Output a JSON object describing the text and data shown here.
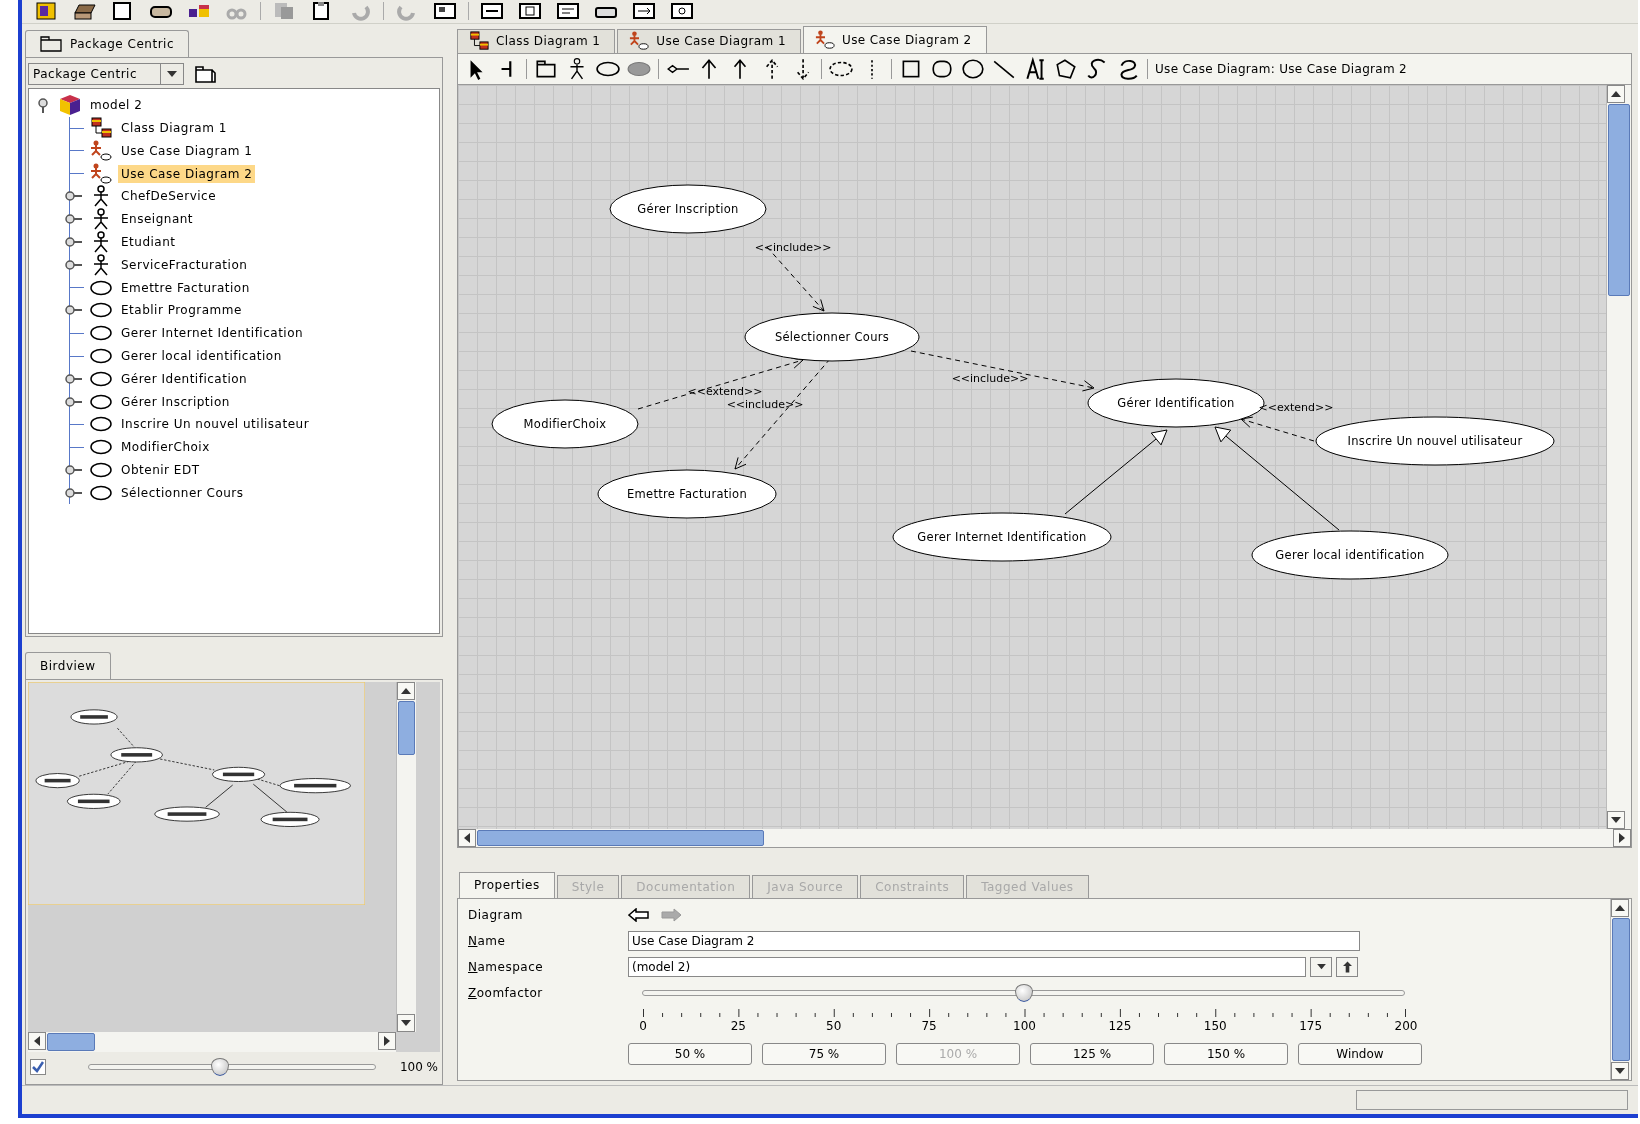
{
  "navigator": {
    "tab": "Package Centric",
    "perspective": "Package Centric",
    "tree": {
      "label": "model 2",
      "kind": "model",
      "expanded": true,
      "selected": false,
      "children": [
        {
          "label": "Class Diagram 1",
          "kind": "class-diagram",
          "expandable": false,
          "selected": false
        },
        {
          "label": "Use Case Diagram 1",
          "kind": "usecase-diagram",
          "expandable": false,
          "selected": false
        },
        {
          "label": "Use Case Diagram 2",
          "kind": "usecase-diagram",
          "expandable": false,
          "selected": true
        },
        {
          "label": "ChefDeService",
          "kind": "actor",
          "expandable": true,
          "selected": false
        },
        {
          "label": "Enseignant",
          "kind": "actor",
          "expandable": true,
          "selected": false
        },
        {
          "label": "Etudiant",
          "kind": "actor",
          "expandable": true,
          "selected": false
        },
        {
          "label": "ServiceFracturation",
          "kind": "actor",
          "expandable": true,
          "selected": false
        },
        {
          "label": "Emettre Facturation",
          "kind": "usecase",
          "expandable": false,
          "selected": false
        },
        {
          "label": "Etablir Programme",
          "kind": "usecase",
          "expandable": true,
          "selected": false
        },
        {
          "label": "Gerer Internet Identification",
          "kind": "usecase",
          "expandable": false,
          "selected": false
        },
        {
          "label": "Gerer local identification",
          "kind": "usecase",
          "expandable": false,
          "selected": false
        },
        {
          "label": "Gérer Identification",
          "kind": "usecase",
          "expandable": true,
          "selected": false
        },
        {
          "label": "Gérer Inscription",
          "kind": "usecase",
          "expandable": true,
          "selected": false
        },
        {
          "label": "Inscrire Un nouvel utilisateur",
          "kind": "usecase",
          "expandable": false,
          "selected": false
        },
        {
          "label": "ModifierChoix",
          "kind": "usecase",
          "expandable": false,
          "selected": false
        },
        {
          "label": "Obtenir EDT",
          "kind": "usecase",
          "expandable": true,
          "selected": false
        },
        {
          "label": "Sélectionner Cours",
          "kind": "usecase",
          "expandable": true,
          "selected": false
        }
      ]
    }
  },
  "birdview": {
    "tab": "Birdview",
    "fit": {
      "checked": true
    },
    "zoom": {
      "level": 0.46,
      "reading": "100 %"
    }
  },
  "editor": {
    "tabs": [
      {
        "label": "Class Diagram 1",
        "kind": "class-diagram",
        "selected": false
      },
      {
        "label": "Use Case Diagram 1",
        "kind": "usecase-diagram",
        "selected": false
      },
      {
        "label": "Use Case Diagram 2",
        "kind": "usecase-diagram",
        "selected": true
      }
    ],
    "toolbar_label": "Use Case Diagram: Use Case Diagram 2",
    "diagram": {
      "nodes": [
        {
          "label": "Gérer Inscription"
        },
        {
          "label": "Sélectionner Cours"
        },
        {
          "label": "ModifierChoix"
        },
        {
          "label": "Emettre Facturation"
        },
        {
          "label": "Gérer Identification"
        },
        {
          "label": "Inscrire Un nouvel utilisateur"
        },
        {
          "label": "Gerer Internet Identification"
        },
        {
          "label": "Gerer local identification"
        }
      ],
      "edges": [
        {
          "kind": "include",
          "label": "<<include>>"
        },
        {
          "kind": "include",
          "label": "<<include>>"
        },
        {
          "kind": "extend",
          "label": "<<extend>>"
        },
        {
          "kind": "include",
          "label": "<<include>>"
        },
        {
          "kind": "extend",
          "label": "<<extend>>"
        },
        {
          "kind": "generalization"
        },
        {
          "kind": "generalization"
        }
      ]
    }
  },
  "properties": {
    "tabs": [
      {
        "label": "Properties",
        "selected": true,
        "disabled": false
      },
      {
        "label": "Style",
        "selected": false,
        "disabled": true
      },
      {
        "label": "Documentation",
        "selected": false,
        "disabled": true
      },
      {
        "label": "Java Source",
        "selected": false,
        "disabled": true
      },
      {
        "label": "Constraints",
        "selected": false,
        "disabled": true
      },
      {
        "label": "Tagged Values",
        "selected": false,
        "disabled": true
      }
    ],
    "diagram_label": "Diagram",
    "fields": [
      {
        "label": "Name",
        "value": "Use Case Diagram 2",
        "kind": "text"
      },
      {
        "label": "Namespace",
        "value": "(model 2)",
        "kind": "combo"
      }
    ],
    "zoom": {
      "label": "Zoomfactor",
      "level": 0.5,
      "ticks": [
        "0",
        "25",
        "50",
        "75",
        "100",
        "125",
        "150",
        "175",
        "200"
      ]
    },
    "buttons": [
      {
        "label": "50 %",
        "disabled": false
      },
      {
        "label": "75 %",
        "disabled": false
      },
      {
        "label": "100 %",
        "disabled": true
      },
      {
        "label": "125 %",
        "disabled": false
      },
      {
        "label": "150 %",
        "disabled": false
      },
      {
        "label": "Window",
        "disabled": false
      }
    ]
  }
}
